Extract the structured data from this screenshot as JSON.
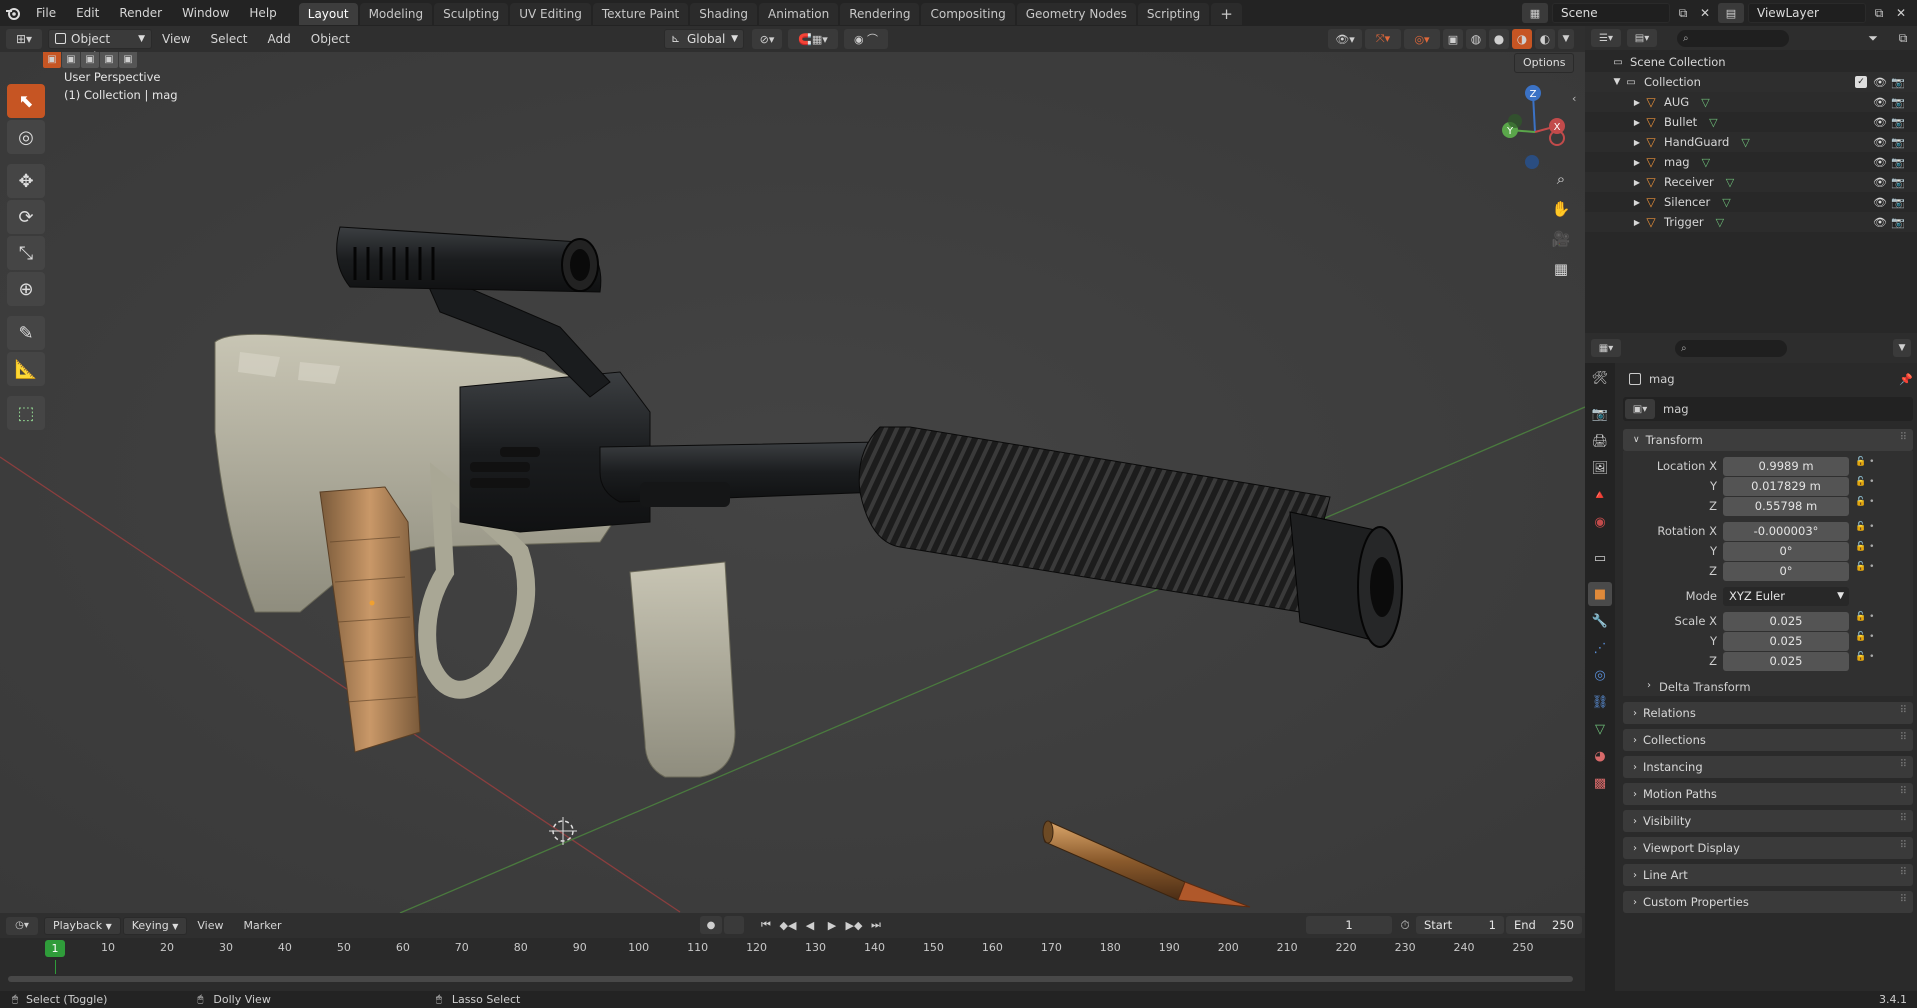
{
  "topbar": {
    "menus": [
      "File",
      "Edit",
      "Render",
      "Window",
      "Help"
    ],
    "workspaces": [
      "Layout",
      "Modeling",
      "Sculpting",
      "UV Editing",
      "Texture Paint",
      "Shading",
      "Animation",
      "Rendering",
      "Compositing",
      "Geometry Nodes",
      "Scripting"
    ],
    "active_workspace": "Layout",
    "scene_label": "Scene",
    "viewlayer_label": "ViewLayer"
  },
  "viewport_header": {
    "mode": "Object Mode",
    "menus": [
      "View",
      "Select",
      "Add",
      "Object"
    ],
    "transform_orientation": "Global",
    "options_label": "Options"
  },
  "viewport": {
    "perspective_label": "User Perspective",
    "collection_label": "(1) Collection | mag",
    "gizmo_axes": [
      "X",
      "Y",
      "Z"
    ]
  },
  "outliner": {
    "root": "Scene Collection",
    "collection": "Collection",
    "items": [
      "AUG",
      "Bullet",
      "HandGuard",
      "mag",
      "Receiver",
      "Silencer",
      "Trigger"
    ],
    "selected_item": "mag"
  },
  "properties": {
    "object_name": "mag",
    "datablock_name": "mag",
    "transform_title": "Transform",
    "location_label": "Location X",
    "location": [
      "0.9989 m",
      "0.017829 m",
      "0.55798 m"
    ],
    "rotation_label": "Rotation X",
    "rotation": [
      "-0.000003°",
      "0°",
      "0°"
    ],
    "mode_label": "Mode",
    "mode_value": "XYZ Euler",
    "scale_label": "Scale X",
    "scale": [
      "0.025",
      "0.025",
      "0.025"
    ],
    "axis_y": "Y",
    "axis_z": "Z",
    "delta_transform": "Delta Transform",
    "panels": [
      "Relations",
      "Collections",
      "Instancing",
      "Motion Paths",
      "Visibility",
      "Viewport Display",
      "Line Art",
      "Custom Properties"
    ]
  },
  "timeline": {
    "menus": [
      "Playback",
      "Keying",
      "View",
      "Marker"
    ],
    "current_frame": "1",
    "start_label": "Start",
    "start_value": "1",
    "end_label": "End",
    "end_value": "250",
    "ruler": [
      "10",
      "20",
      "30",
      "40",
      "50",
      "60",
      "70",
      "80",
      "90",
      "100",
      "110",
      "120",
      "130",
      "140",
      "150",
      "160",
      "170",
      "180",
      "190",
      "200",
      "210",
      "220",
      "230",
      "240",
      "250"
    ],
    "playhead": "1"
  },
  "statusbar": {
    "hint1": "Select (Toggle)",
    "hint2": "Dolly View",
    "hint3": "Lasso Select",
    "version": "3.4.1"
  },
  "colors": {
    "accent": "#c65523",
    "selected_row": "#334d80",
    "playhead": "#2f9c3a",
    "x_axis": "#c24b4b",
    "y_axis": "#5aa64a",
    "z_axis": "#3b72c5"
  }
}
